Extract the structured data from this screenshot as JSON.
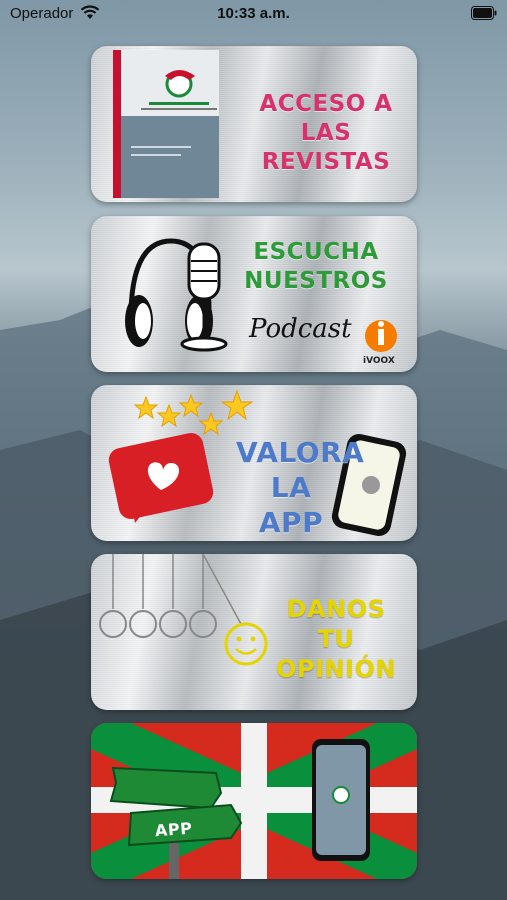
{
  "status_bar": {
    "carrier": "Operador",
    "time": "10:33 a.m."
  },
  "cards": [
    {
      "title": "ACCESO A LAS REVISTAS",
      "color": "#d6336c"
    },
    {
      "title": "ESCUCHA NUESTROS",
      "subtitle": "Podcast",
      "badge": "iVOOX",
      "color": "#2f9a3a"
    },
    {
      "title": "VALORA LA APP",
      "color": "#4d7bc9"
    },
    {
      "title": "DANOS TU OPINIÓN",
      "color": "#e6d400"
    },
    {
      "badge": "APP"
    }
  ]
}
